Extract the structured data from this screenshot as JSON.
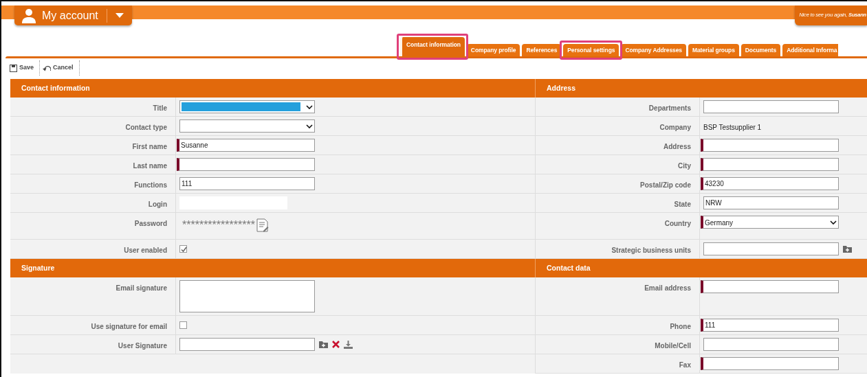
{
  "header": {
    "account_button": "My account",
    "greeting": "Nice to see you again, **Susann**"
  },
  "tabs": [
    {
      "label": "Contact information",
      "selected": true,
      "highlighted": true
    },
    {
      "label": "Company profile",
      "selected": false,
      "highlighted": false
    },
    {
      "label": "References",
      "selected": false,
      "highlighted": false
    },
    {
      "label": "Personal settings",
      "selected": false,
      "highlighted": true
    },
    {
      "label": "Company Addresses",
      "selected": false,
      "highlighted": false
    },
    {
      "label": "Material groups",
      "selected": false,
      "highlighted": false
    },
    {
      "label": "Documents",
      "selected": false,
      "highlighted": false
    },
    {
      "label": "Additional Informa",
      "selected": false,
      "highlighted": false
    }
  ],
  "toolbar": [
    {
      "label": "Save",
      "kind": "save"
    },
    {
      "label": "Cancel",
      "kind": "cancel"
    }
  ],
  "sections": [
    {
      "left": {
        "title": "Contact information",
        "rows": [
          {
            "label": "Title",
            "kind": "select",
            "focused": true,
            "required": false
          },
          {
            "label": "Contact type",
            "kind": "select",
            "focused": false,
            "required": false
          },
          {
            "label": "First name",
            "kind": "input",
            "value": "Susanne",
            "required": true
          },
          {
            "label": "Last name",
            "kind": "input",
            "required": true
          },
          {
            "label": "Functions",
            "kind": "input",
            "value": "111",
            "required": false
          },
          {
            "label": "Login",
            "kind": "readonly"
          },
          {
            "label": "Password",
            "kind": "password",
            "value": "*****************"
          },
          {
            "label": "User enabled",
            "kind": "checkbox",
            "checked": true
          }
        ]
      },
      "right": {
        "title": "Address",
        "rows": [
          {
            "label": "Departments",
            "kind": "input",
            "required": false
          },
          {
            "label": "Company",
            "kind": "text",
            "value": "BSP Testsupplier 1"
          },
          {
            "label": "Address",
            "kind": "input",
            "required": true
          },
          {
            "label": "City",
            "kind": "input",
            "required": true
          },
          {
            "label": "Postal/Zip code",
            "kind": "input",
            "value": "43230",
            "required": true
          },
          {
            "label": "State",
            "kind": "input",
            "value": "NRW",
            "required": false
          },
          {
            "label": "Country",
            "kind": "select",
            "value": "Germany",
            "focused": false,
            "required": true
          },
          {
            "label": "Strategic business units",
            "kind": "input",
            "required": false,
            "actions": [
              {
                "kind": "add"
              }
            ]
          }
        ]
      }
    },
    {
      "left": {
        "title": "Signature",
        "rows": [
          {
            "label": "Email signature",
            "kind": "textarea"
          },
          {
            "label": "Use signature for email",
            "kind": "checkbox",
            "checked": false
          },
          {
            "label": "User Signature",
            "kind": "input",
            "required": false,
            "actions": [
              {
                "kind": "add"
              },
              {
                "kind": "delete"
              },
              {
                "kind": "download"
              }
            ]
          }
        ]
      },
      "right": {
        "title": "Contact data",
        "rows": [
          {
            "label": "Email address",
            "kind": "input",
            "required": true
          },
          {
            "label": "Phone",
            "kind": "input",
            "value": "111",
            "required": true
          },
          {
            "label": "Mobile/Cell",
            "kind": "input",
            "required": false
          },
          {
            "label": "Fax",
            "kind": "input",
            "required": true
          }
        ]
      }
    }
  ]
}
